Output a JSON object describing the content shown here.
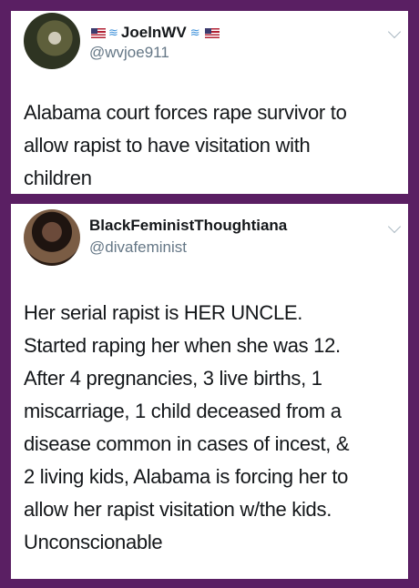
{
  "tweets": [
    {
      "display_name": "JoelnWV",
      "handle": "@wvjoe911",
      "text": "Alabama court forces rape survivor to\nallow rapist to have visitation with\nchildren"
    },
    {
      "display_name": "BlackFeministThoughtiana",
      "handle": "@divafeminist",
      "text": "Her serial rapist is HER UNCLE.\nStarted raping her when she was 12.\nAfter 4 pregnancies, 3 live births, 1\nmiscarriage, 1 child deceased from a\ndisease common in cases of incest, &\n2 living kids, Alabama is forcing her to\nallow her rapist visitation w/the kids.\nUnconscionable"
    }
  ],
  "icons": {
    "flag": "us-flag-icon",
    "wave": "wave-icon",
    "menu": "chevron-down-icon"
  },
  "colors": {
    "background": "#5a1f63",
    "card": "#ffffff",
    "text": "#14171a",
    "handle": "#657786"
  }
}
